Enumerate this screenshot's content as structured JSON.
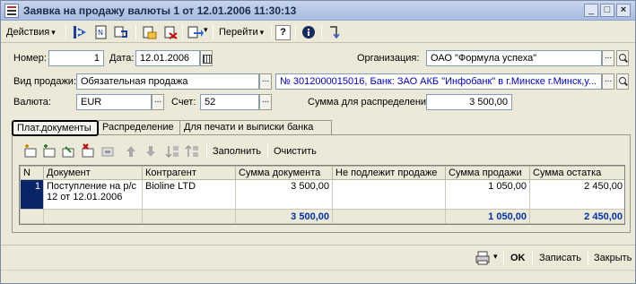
{
  "window": {
    "title": "Заявка на продажу валюты 1 от 12.01.2006 11:30:13"
  },
  "toolbar": {
    "actions_label": "Действия",
    "goto_label": "Перейти",
    "help_label": "?"
  },
  "form": {
    "number_label": "Номер:",
    "number_value": "1",
    "date_label": "Дата:",
    "date_value": "12.01.2006",
    "org_label": "Организация:",
    "org_value": "ОАО \"Формула успеха\"",
    "sale_type_label": "Вид продажи:",
    "sale_type_value": "Обязательная продажа",
    "account_link": "№ 3012000015016, Банк: ЗАО АКБ \"Инфобанк\" в г.Минске г.Минск,у...",
    "currency_label": "Валюта:",
    "currency_value": "EUR",
    "acct_label": "Счет:",
    "acct_value": "52",
    "dist_label": "Сумма для распределения:",
    "dist_value": "3 500,00"
  },
  "tabs": [
    {
      "label": "Плат.документы"
    },
    {
      "label": "Распределение"
    },
    {
      "label": "Для печати и выписки банка"
    }
  ],
  "panel_toolbar": {
    "fill_label": "Заполнить",
    "clear_label": "Очистить"
  },
  "table": {
    "headers": [
      "N",
      "Документ",
      "Контрагент",
      "Сумма документа",
      "Не подлежит продаже",
      "Сумма продажи",
      "Сумма остатка"
    ],
    "rows": [
      {
        "n": "1",
        "doc": "Поступление на р/с 12 от 12.01.2006",
        "contractor": "Bioline LTD",
        "doc_sum": "3 500,00",
        "not_for_sale": "",
        "sale_sum": "1 050,00",
        "rest_sum": "2 450,00"
      }
    ],
    "totals": {
      "doc_sum": "3 500,00",
      "sale_sum": "1 050,00",
      "rest_sum": "2 450,00"
    }
  },
  "bottom": {
    "ok_label": "OK",
    "save_label": "Записать",
    "close_label": "Закрыть"
  },
  "colors": {
    "title_bg": "#b6c7e6",
    "window_bg": "#ece9d8",
    "link": "#0000cc",
    "total_text": "#0033aa"
  }
}
